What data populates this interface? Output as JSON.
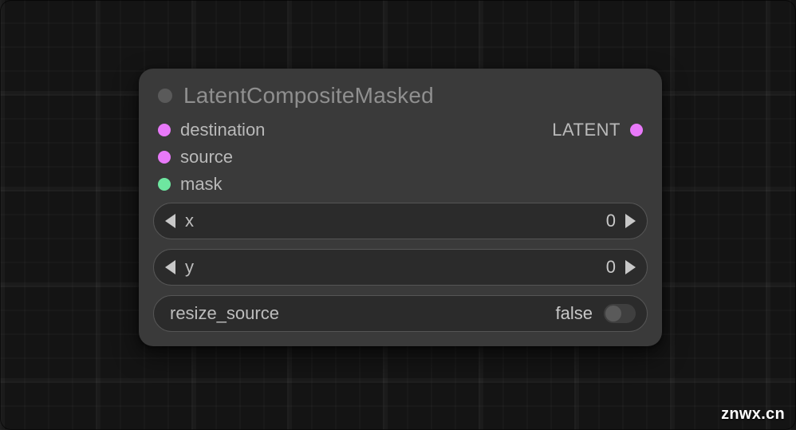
{
  "node": {
    "title": "LatentCompositeMasked",
    "inputs": [
      {
        "label": "destination",
        "port_type": "latent"
      },
      {
        "label": "source",
        "port_type": "latent"
      },
      {
        "label": "mask",
        "port_type": "mask"
      }
    ],
    "outputs": [
      {
        "label": "LATENT",
        "port_type": "latent"
      }
    ],
    "widgets": {
      "x": {
        "label": "x",
        "value": "0"
      },
      "y": {
        "label": "y",
        "value": "0"
      },
      "resize_source": {
        "label": "resize_source",
        "value": "false"
      }
    }
  },
  "watermark": "znwx.cn"
}
